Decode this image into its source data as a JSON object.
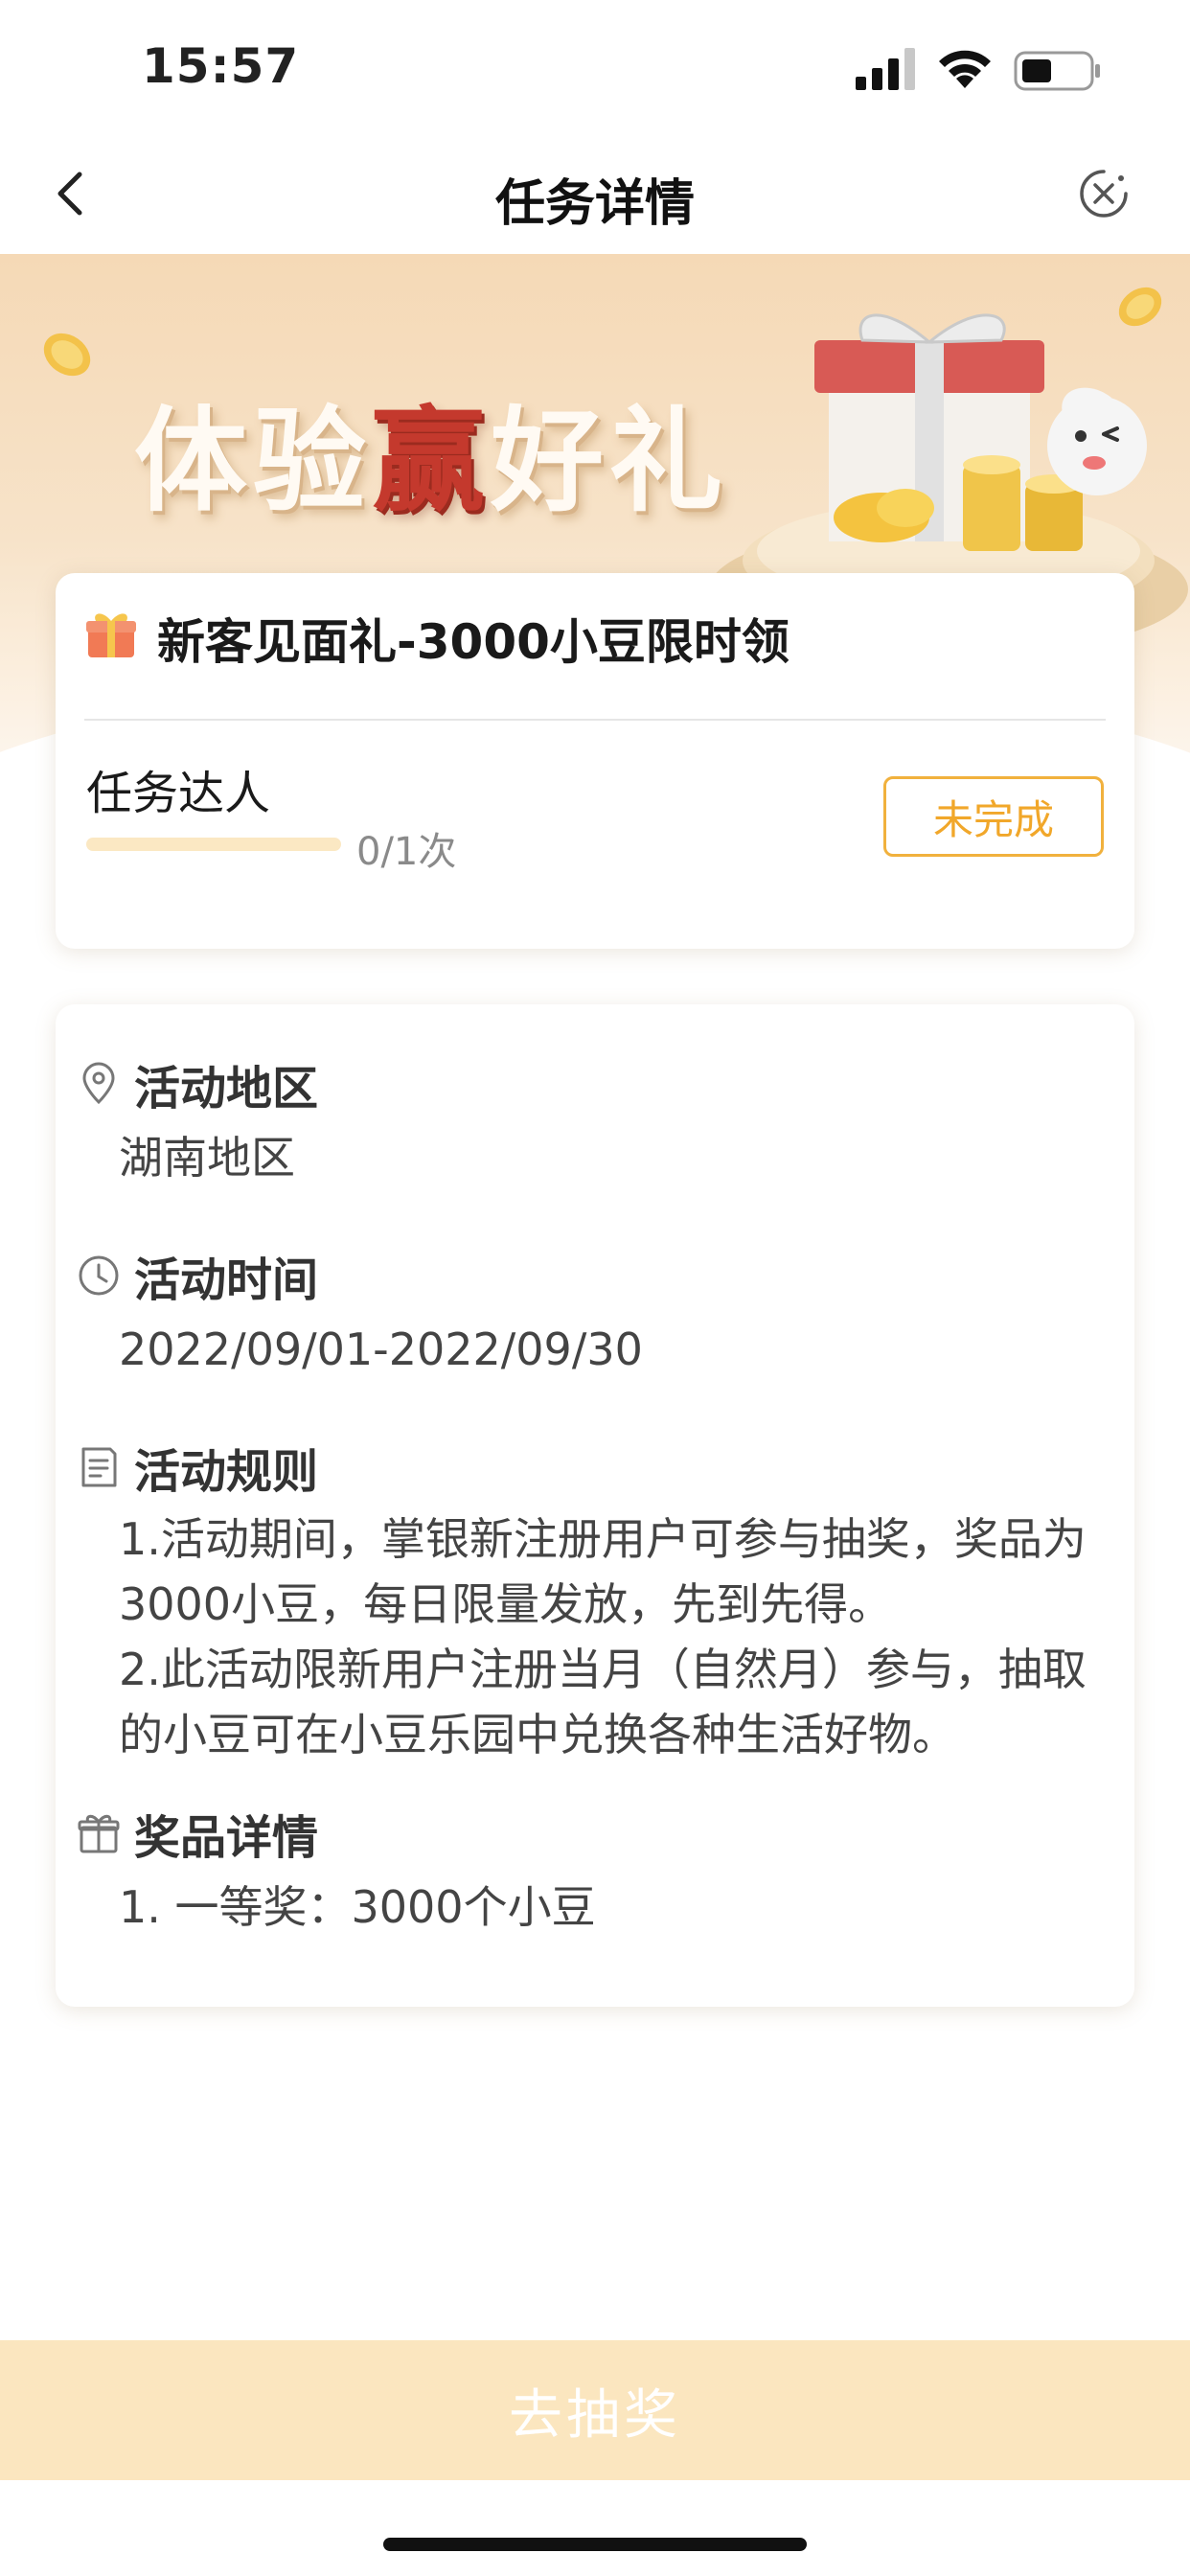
{
  "status_bar": {
    "time": "15:57"
  },
  "nav": {
    "title": "任务详情"
  },
  "banner": {
    "title_prefix": "体验",
    "title_highlight": "赢",
    "title_suffix": "好礼"
  },
  "task": {
    "name": "新客见面礼-3000小豆限时领",
    "role": "任务达人",
    "progress_text": "0/1次",
    "progress_fraction": 0,
    "status_label": "未完成"
  },
  "info": {
    "region": {
      "title": "活动地区",
      "value": "湖南地区"
    },
    "time": {
      "title": "活动时间",
      "value": "2022/09/01-2022/09/30"
    },
    "rules": {
      "title": "活动规则",
      "lines": [
        "1.活动期间，掌银新注册用户可参与抽奖，奖品为3000小豆，每日限量发放，先到先得。",
        "2.此活动限新用户注册当月（自然月）参与，抽取的小豆可在小豆乐园中兑换各种生活好物。"
      ]
    },
    "prize": {
      "title": "奖品详情",
      "value": "1. 一等奖：3000个小豆"
    }
  },
  "bottom": {
    "button_label": "去抽奖"
  },
  "colors": {
    "accent": "#f1b13d",
    "button_bg": "#fbe6bf",
    "banner_highlight": "#c4392d"
  },
  "icons": [
    "chevron-left-icon",
    "close-circle-icon",
    "gift-icon",
    "location-pin-icon",
    "clock-icon",
    "document-icon",
    "gift-outline-icon"
  ]
}
